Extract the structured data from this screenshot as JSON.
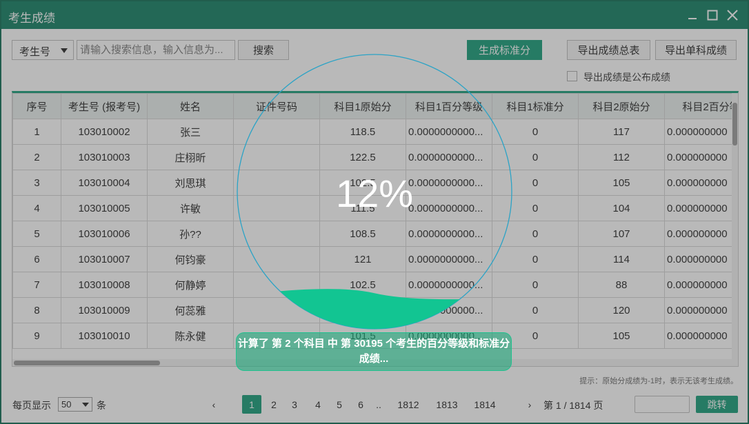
{
  "window": {
    "title": "考生成绩"
  },
  "toolbar": {
    "field_select": "考生号",
    "search_placeholder": "请输入搜索信息，输入信息为...",
    "search_label": "搜索",
    "generate_label": "生成标准分",
    "export_total_label": "导出成绩总表",
    "export_single_label": "导出单科成绩",
    "public_checkbox_label": "导出成绩是公布成绩",
    "public_checked": false
  },
  "table": {
    "columns": [
      "序号",
      "考生号 (报考号)",
      "姓名",
      "证件号码",
      "科目1原始分",
      "科目1百分等级",
      "科目1标准分",
      "科目2原始分",
      "科目2百分等"
    ],
    "rows": [
      [
        "1",
        "103010002",
        "张三",
        "",
        "118.5",
        "0.0000000000...",
        "0",
        "117",
        "0.000000000"
      ],
      [
        "2",
        "103010003",
        "庄栩昕",
        "",
        "122.5",
        "0.0000000000...",
        "0",
        "112",
        "0.000000000"
      ],
      [
        "3",
        "103010004",
        "刘思琪",
        "",
        "102.5",
        "0.0000000000...",
        "0",
        "105",
        "0.000000000"
      ],
      [
        "4",
        "103010005",
        "许敏",
        "",
        "111.5",
        "0.0000000000...",
        "0",
        "104",
        "0.000000000"
      ],
      [
        "5",
        "103010006",
        "孙??",
        "",
        "108.5",
        "0.0000000000...",
        "0",
        "107",
        "0.000000000"
      ],
      [
        "6",
        "103010007",
        "何钧豪",
        "",
        "121",
        "0.0000000000...",
        "0",
        "114",
        "0.000000000"
      ],
      [
        "7",
        "103010008",
        "何静婷",
        "",
        "102.5",
        "0.0000000000...",
        "0",
        "88",
        "0.000000000"
      ],
      [
        "8",
        "103010009",
        "何蕊雅",
        "",
        "",
        "0.0000000000...",
        "0",
        "120",
        "0.000000000"
      ],
      [
        "9",
        "103010010",
        "陈永健",
        "",
        "101.5",
        "0.0000000000...",
        "0",
        "105",
        "0.000000000"
      ]
    ]
  },
  "hint": "提示：原始分成绩为-1时，表示无该考生成绩。",
  "pagination": {
    "per_page_label": "每页显示",
    "per_page_value": "50",
    "per_page_unit": "条",
    "prev": "‹",
    "next": "›",
    "pages": [
      "1",
      "2",
      "3",
      "4",
      "5",
      "6",
      "..",
      "1812",
      "1813",
      "1814"
    ],
    "current_page": "1",
    "page_info": "第 1 / 1814 页",
    "jump_label": "跳转"
  },
  "progress": {
    "percent_text": "12%",
    "percent_value": 0.12,
    "message": "计算了 第 2 个科目 中 第 30195 个考生的百分等级和标准分成绩..."
  },
  "colors": {
    "accent": "#139b76",
    "title_bar": "#0d7c5f",
    "wave": "#12c592"
  },
  "icons": [
    "minimize-icon",
    "maximize-icon",
    "close-icon",
    "dropdown-caret-icon"
  ]
}
